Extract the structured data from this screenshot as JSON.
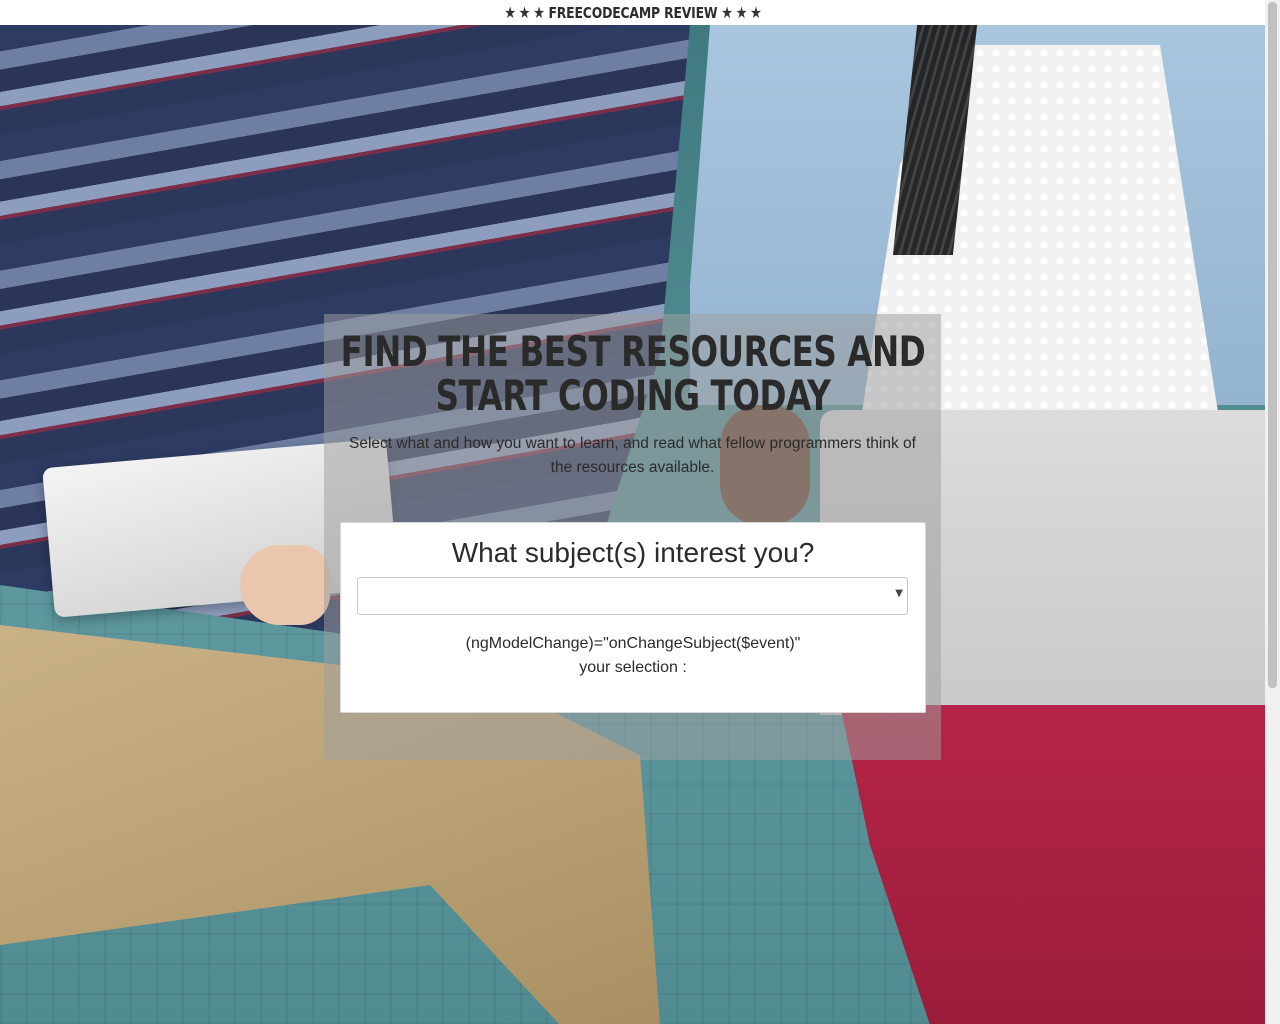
{
  "header": {
    "brand": "FREECODECAMP REVIEW",
    "star_icon": "star-icon",
    "star_glyph": "★"
  },
  "hero": {
    "headline": "FIND THE BEST RESOURCES AND START CODING TODAY",
    "subtitle": "Select what and how you want to learn, and read what fellow programmers think of the resources available."
  },
  "subject_card": {
    "title": "What subject(s) interest you?",
    "select_value": "",
    "caret_glyph": "▼",
    "binding_text": "(ngModelChange)=\"onChangeSubject($event)\"",
    "selection_label": "your selection :"
  }
}
